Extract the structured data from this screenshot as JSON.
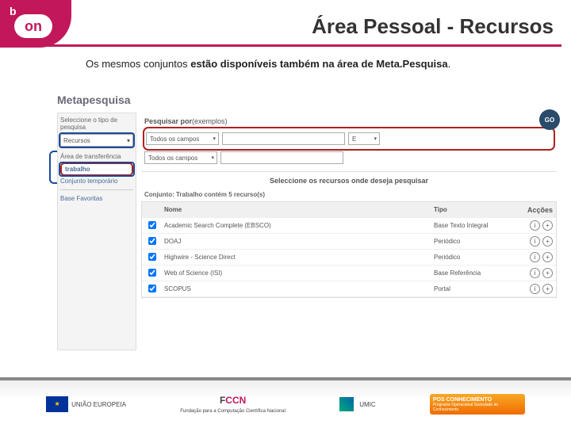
{
  "logo": {
    "b": "b",
    "on": "on"
  },
  "page": {
    "title": "Área Pessoal - Recursos",
    "intro_pre": "Os mesmos conjuntos ",
    "intro_bold": "estão disponíveis também na área de Meta.Pesquisa",
    "intro_post": "."
  },
  "meta": {
    "heading": "Metapesquisa",
    "sidebar": {
      "select_label": "Seleccione o tipo de pesquisa",
      "select_value": "Recursos",
      "area_label": "Área de transferência",
      "trabalho": "trabalho",
      "conj_temp": "Conjunto temporário",
      "base_fav": "Base Favoritas"
    },
    "tabs": {
      "active": "Pesquisar por",
      "example": "(exemplos)"
    },
    "search": {
      "field_all": "Todos os campos",
      "op": "E"
    },
    "go": "GO",
    "select_resources": "Seleccione os recursos onde deseja pesquisar",
    "conjunto_line": "Conjunto: Trabalho contém 5 recurso(s)",
    "table": {
      "col_name": "Nome",
      "col_type": "Tipo",
      "col_actions": "Acções",
      "rows": [
        {
          "name": "Academic Search Complete (EBSCO)",
          "type": "Base Texto Integral"
        },
        {
          "name": "DOAJ",
          "type": "Periódico"
        },
        {
          "name": "Highwire - Science Direct",
          "type": "Periódico"
        },
        {
          "name": "Web of Science (ISI)",
          "type": "Base Referência"
        },
        {
          "name": "SCOPUS",
          "type": "Portal"
        }
      ]
    },
    "icons": {
      "info": "i",
      "add": "+"
    }
  },
  "footer": {
    "eu": "UNIÃO EUROPEIA",
    "fccn": "FCCN",
    "fccn_sub": "Fundação para a Computação Científica Nacional",
    "umic": "UMIC",
    "pos_top": "POS CONHECIMENTO",
    "pos_sub": "Programa Operacional Sociedade do Conhecimento"
  }
}
